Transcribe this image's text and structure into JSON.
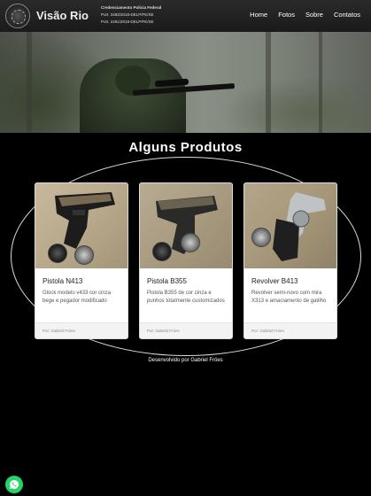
{
  "header": {
    "brand": "Visão Rio",
    "license": {
      "title": "Credenciamento Polícia Federal",
      "line1": "Port. 3482/2018-DELP/FE/SE",
      "line2": "Port. 2291/2018-DELP/FE/SE"
    },
    "nav": [
      {
        "label": "Home"
      },
      {
        "label": "Fotos"
      },
      {
        "label": "Sobre"
      },
      {
        "label": "Contatos"
      }
    ]
  },
  "products": {
    "heading": "Alguns Produtos",
    "items": [
      {
        "title": "Pistola N413",
        "description": "Glock modelo v433 cor cinza bege e pegador modificado",
        "footer": "Por: Gabriel Fróes"
      },
      {
        "title": "Pistola B355",
        "description": "Pistola B355 de cor cinza e punhos totalmente customizados",
        "footer": "Por: Gabriel Fróes"
      },
      {
        "title": "Revolver B413",
        "description": "Revolver semi-novo com mira X313 e amaciamento de gatilho",
        "footer": "Por: Gabriel Fróes"
      }
    ]
  },
  "footer": {
    "credit": "Desenvolvido por Gabriel Fróes"
  },
  "icons": {
    "logo": "police-emblem-icon",
    "whatsapp": "whatsapp-icon"
  },
  "colors": {
    "background": "#000000",
    "navbar": "#222222",
    "whatsapp": "#25d366"
  }
}
